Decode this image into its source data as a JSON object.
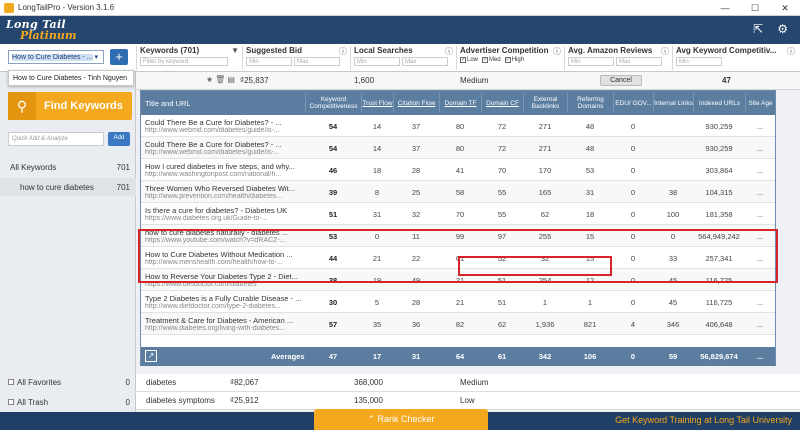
{
  "window": {
    "title": "LongTailPro - Version 3.1.6",
    "minimize": "—",
    "maximize": "☐",
    "close": "✕"
  },
  "logo": {
    "line1": "Long Tail",
    "line2": "Platinum"
  },
  "header_icons": {
    "export": "⇱",
    "settings": "⚙"
  },
  "project": {
    "selected": "How to Cure Diabetes - ...",
    "dropdown_item": "How to Cure Diabetes - Tinh Nguyen"
  },
  "filters": {
    "keywords": {
      "label": "Keywords (701)",
      "placeholder": "Filter by keyword"
    },
    "suggested_bid": {
      "label": "Suggested Bid",
      "min": "Min",
      "max": "Max"
    },
    "local_searches": {
      "label": "Local Searches",
      "min": "Min",
      "max": "Max"
    },
    "advertiser_competition": {
      "label": "Advertiser Competition",
      "low": "Low",
      "med": "Med",
      "high": "High"
    },
    "amazon_reviews": {
      "label": "Avg. Amazon Reviews",
      "min": "Min",
      "max": "Max"
    },
    "avg_kc": {
      "label": "Avg Keyword Competitiv...",
      "min": "Min"
    }
  },
  "sidebar": {
    "find_keywords": "Find Keywords",
    "quick_placeholder": "Quick Add & Analyze",
    "add": "Add",
    "items": [
      {
        "label": "All Keywords",
        "count": "701"
      },
      {
        "label": "how to cure diabetes",
        "count": "701"
      }
    ],
    "favorites": {
      "label": "All Favorites",
      "count": "0"
    },
    "trash": {
      "label": "All Trash",
      "count": "0"
    }
  },
  "keyword_row": {
    "bid": "₫25,837",
    "local": "1,600",
    "competition": "Medium",
    "cancel": "Cancel",
    "kc": "47"
  },
  "table": {
    "columns": [
      "Title and URL",
      "Keyword Competitiveness",
      "Trust Flow",
      "Citation Flow",
      "Domain TF",
      "Domain CF",
      "External Backlinks",
      "Referring Domains",
      "EDU/ GOV...",
      "Internal Links",
      "Indexed URLs",
      "Site Age"
    ],
    "rows": [
      {
        "title": "Could There Be a Cure for Diabetes? - ...",
        "url": "http://www.webmd.com/diabetes/guide/is-...",
        "kc": "54",
        "tf": "14",
        "cf": "37",
        "dtf": "80",
        "dcf": "72",
        "eb": "271",
        "rd": "48",
        "edu": "0",
        "il": "",
        "iu": "930,259",
        "age": "..."
      },
      {
        "title": "Could There Be a Cure for Diabetes? - ...",
        "url": "http://www.webmd.com/diabetes/guide/is-...",
        "kc": "54",
        "tf": "14",
        "cf": "37",
        "dtf": "80",
        "dcf": "72",
        "eb": "271",
        "rd": "48",
        "edu": "0",
        "il": "",
        "iu": "930,259",
        "age": "..."
      },
      {
        "title": "How I cured diabetes in five steps, and why...",
        "url": "http://www.washingtonpost.com/national/h...",
        "kc": "46",
        "tf": "18",
        "cf": "28",
        "dtf": "41",
        "dcf": "70",
        "eb": "170",
        "rd": "53",
        "edu": "0",
        "il": "",
        "iu": "303,864",
        "age": "..."
      },
      {
        "title": "Three Women Who Reversed Diabetes Wit...",
        "url": "http://www.prevention.com/health/diabetes...",
        "kc": "39",
        "tf": "8",
        "cf": "25",
        "dtf": "58",
        "dcf": "55",
        "eb": "165",
        "rd": "31",
        "edu": "0",
        "il": "38",
        "iu": "104,315",
        "age": "..."
      },
      {
        "title": "Is there a cure for diabetes? - Diabetes UK",
        "url": "https://www.diabetes.org.uk/Guide-to-...",
        "kc": "51",
        "tf": "31",
        "cf": "32",
        "dtf": "70",
        "dcf": "55",
        "eb": "62",
        "rd": "18",
        "edu": "0",
        "il": "100",
        "iu": "181,358",
        "age": "..."
      },
      {
        "title": "how to cure diabetes naturally - diabetes ...",
        "url": "https://www.youtube.com/watch?v=dRACZ-...",
        "kc": "53",
        "tf": "0",
        "cf": "11",
        "dtf": "99",
        "dcf": "97",
        "eb": "255",
        "rd": "15",
        "edu": "0",
        "il": "0",
        "iu": "564,949,242",
        "age": "..."
      },
      {
        "title": "How to Cure Diabetes Without Medication ...",
        "url": "http://www.menshealth.com/health/how-to-...",
        "kc": "44",
        "tf": "21",
        "cf": "22",
        "dtf": "61",
        "dcf": "52",
        "eb": "32",
        "rd": "15",
        "edu": "0",
        "il": "33",
        "iu": "257,341",
        "age": "..."
      },
      {
        "title": "How to Reverse Your Diabetes Type 2 - Diet...",
        "url": "https://www.dietdoctor.com/diabetes",
        "kc": "38",
        "tf": "19",
        "cf": "49",
        "dtf": "21",
        "dcf": "51",
        "eb": "254",
        "rd": "12",
        "edu": "0",
        "il": "45",
        "iu": "116,725",
        "age": "..."
      },
      {
        "title": "Type 2 Diabetes is a Fully Curable Disease - ...",
        "url": "http://www.dietdoctor.com/type-2-diabetes...",
        "kc": "30",
        "tf": "5",
        "cf": "28",
        "dtf": "21",
        "dcf": "51",
        "eb": "1",
        "rd": "1",
        "edu": "0",
        "il": "45",
        "iu": "116,725",
        "age": "..."
      },
      {
        "title": "Treatment & Care for Diabetes - American ...",
        "url": "http://www.diabetes.org/living-with-diabetes...",
        "kc": "57",
        "tf": "35",
        "cf": "36",
        "dtf": "82",
        "dcf": "62",
        "eb": "1,936",
        "rd": "821",
        "edu": "4",
        "il": "346",
        "iu": "406,648",
        "age": "..."
      }
    ],
    "averages": {
      "label": "Averages",
      "kc": "47",
      "tf": "17",
      "cf": "31",
      "dtf": "64",
      "dcf": "61",
      "eb": "342",
      "rd": "106",
      "edu": "0",
      "il": "59",
      "iu": "56,829,674",
      "age": "..."
    }
  },
  "bottom_keywords": [
    {
      "kw": "diabetes",
      "bid": "₫82,067",
      "local": "368,000",
      "comp": "Medium"
    },
    {
      "kw": "diabetes symptoms",
      "bid": "₫25,912",
      "local": "135,000",
      "comp": "Low"
    }
  ],
  "footer": {
    "rank_checker": "Rank Checker",
    "training": "Get Keyword Training at Long Tail University"
  }
}
